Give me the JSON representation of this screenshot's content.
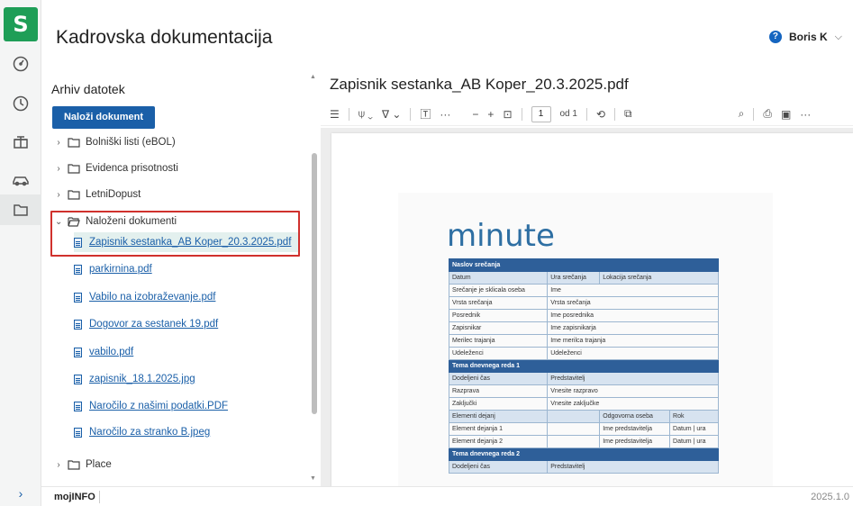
{
  "app": {
    "logo": "S",
    "page_title": "Kadrovska dokumentacija",
    "user_name": "Boris K",
    "help": "?"
  },
  "archive": {
    "title": "Arhiv datotek",
    "upload_label": "Naloži dokument",
    "folders": [
      {
        "label": "Bolniški listi (eBOL)",
        "arrow": "›"
      },
      {
        "label": "Evidenca prisotnosti",
        "arrow": "›"
      },
      {
        "label": "LetniDopust",
        "arrow": "›"
      },
      {
        "label": "Naloženi dokumenti",
        "arrow": "⌄"
      }
    ],
    "files": [
      "Zapisnik sestanka_AB Koper_20.3.2025.pdf",
      "parkirnina.pdf",
      "Vabilo na izobraževanje.pdf",
      "Dogovor za sestanek 19.pdf",
      "vabilo.pdf",
      "zapisnik_18.1.2025.jpg",
      "Naročilo z našimi podatki.PDF",
      "Naročilo za stranko B.jpeg"
    ],
    "last_folder": {
      "label": "Place",
      "arrow": "›"
    }
  },
  "viewer": {
    "doc_title": "Zapisnik sestanka_AB Koper_20.3.2025.pdf",
    "page_current": "1",
    "page_total": "od 1",
    "doc": {
      "heading": "minute",
      "rows": [
        {
          "type": "hd",
          "cells": [
            "Naslov srečanja"
          ]
        },
        {
          "type": "sub",
          "cells": [
            "Datum",
            "Ura srečanja",
            "Lokacija srečanja"
          ]
        },
        {
          "type": "row",
          "cells": [
            "Srečanje je sklicala oseba",
            "Ime"
          ]
        },
        {
          "type": "row",
          "cells": [
            "Vrsta srečanja",
            "Vrsta srečanja"
          ]
        },
        {
          "type": "row",
          "cells": [
            "Posrednik",
            "Ime posrednika"
          ]
        },
        {
          "type": "row",
          "cells": [
            "Zapisnikar",
            "Ime zapisnikarja"
          ]
        },
        {
          "type": "row",
          "cells": [
            "Merilec trajanja",
            "Ime merilca trajanja"
          ]
        },
        {
          "type": "row",
          "cells": [
            "Udeleženci",
            "Udeleženci"
          ]
        },
        {
          "type": "hd",
          "cells": [
            "Tema dnevnega reda 1"
          ]
        },
        {
          "type": "sub",
          "cells": [
            "Dodeljeni čas",
            "Predstavitelj"
          ]
        },
        {
          "type": "row",
          "cells": [
            "Razprava",
            "Vnesite razpravo"
          ]
        },
        {
          "type": "row",
          "cells": [
            "Zaključki",
            "Vnesite zaključke"
          ]
        },
        {
          "type": "sub",
          "cells": [
            "Elementi dejanj",
            "",
            "Odgovorna oseba",
            "Rok"
          ]
        },
        {
          "type": "row",
          "cells": [
            "Element dejanja 1",
            "",
            "Ime predstavitelja",
            "Datum | ura"
          ]
        },
        {
          "type": "row",
          "cells": [
            "Element dejanja 2",
            "",
            "Ime predstavitelja",
            "Datum | ura"
          ]
        },
        {
          "type": "hd",
          "cells": [
            "Tema dnevnega reda 2"
          ]
        },
        {
          "type": "sub",
          "cells": [
            "Dodeljeni čas",
            "Predstavitelj"
          ]
        }
      ]
    }
  },
  "status": {
    "app_name": "mojINFO",
    "version": "2025.1.0",
    "expand": "›"
  }
}
